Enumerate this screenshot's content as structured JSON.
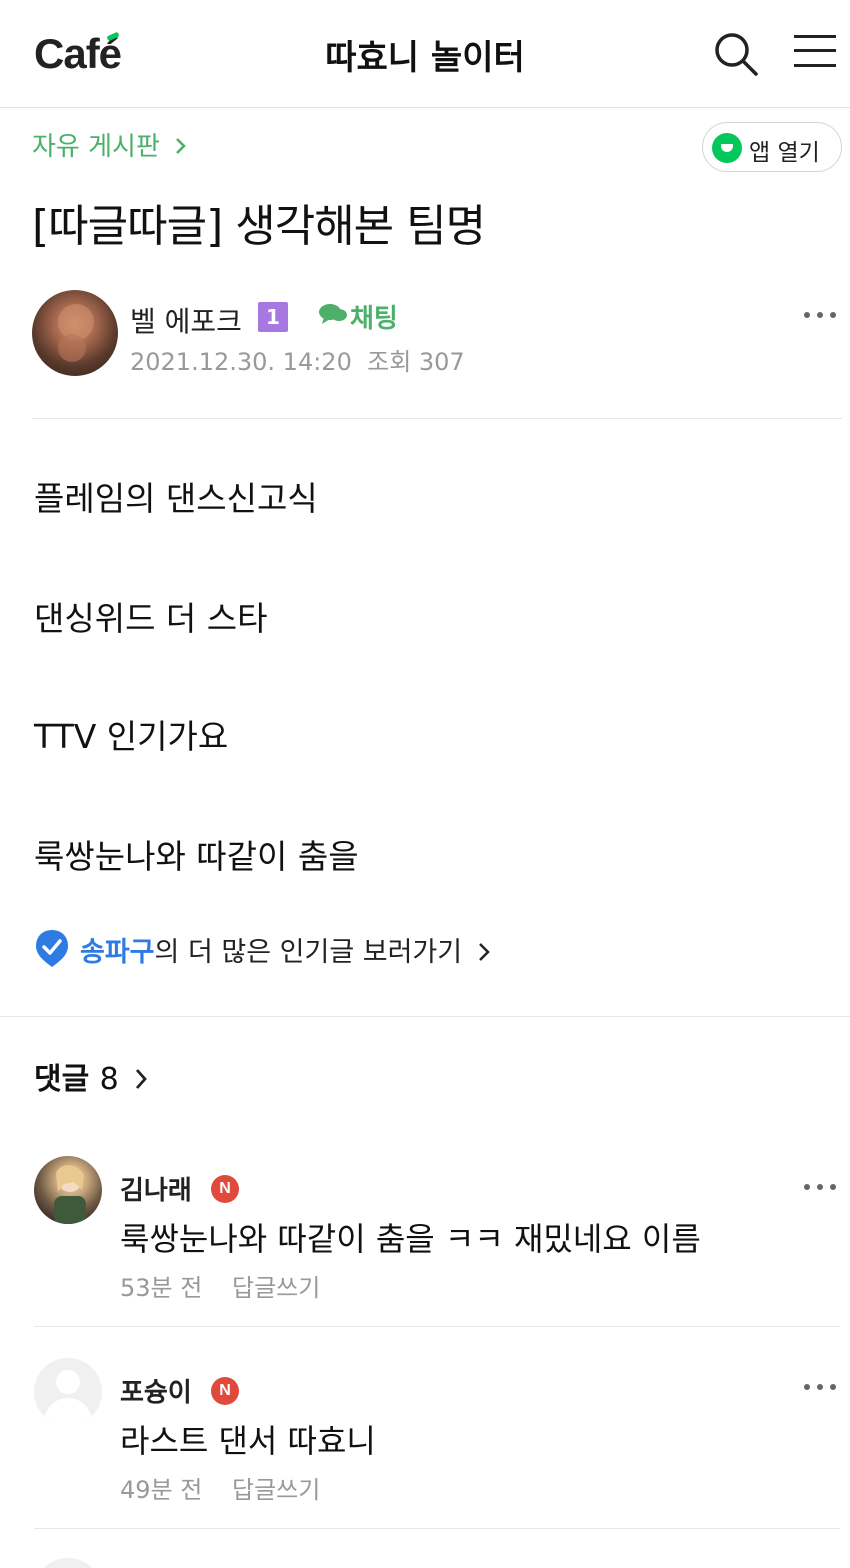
{
  "header": {
    "logo": "Café",
    "cafe_title": "따효니 놀이터"
  },
  "post": {
    "board": "자유 게시판",
    "app_open_label": "앱 열기",
    "title": "[따글따글] 생각해본 팀명",
    "author": "벨 에포크",
    "author_level": "1",
    "chat_label": "채팅",
    "date": "2021.12.30. 14:20",
    "views": "조회 307",
    "body": [
      "플레임의 댄스신고식",
      "댄싱위드 더 스타",
      "TTV 인기가요",
      "룩쌍눈나와 따같이 춤을"
    ],
    "popular": {
      "place": "송파구",
      "suffix": "의 더 많은 인기글 보러가기"
    }
  },
  "comments": {
    "label": "댓글",
    "count": "8",
    "reply_label": "답글쓰기",
    "items": [
      {
        "name": "김나래",
        "badge": "N",
        "text": "룩쌍눈나와 따같이 춤을 ㅋㅋ 재밌네요 이름",
        "time": "53분 전"
      },
      {
        "name": "포슝이",
        "badge": "N",
        "text": "라스트 댄서 따효니",
        "time": "49분 전"
      }
    ]
  },
  "colors": {
    "brand_green": "#03c75a",
    "board_green": "#4caf6a",
    "link_blue": "#2e7be4",
    "new_badge_red": "#e04a3c",
    "level_purple": "#a678e0"
  }
}
